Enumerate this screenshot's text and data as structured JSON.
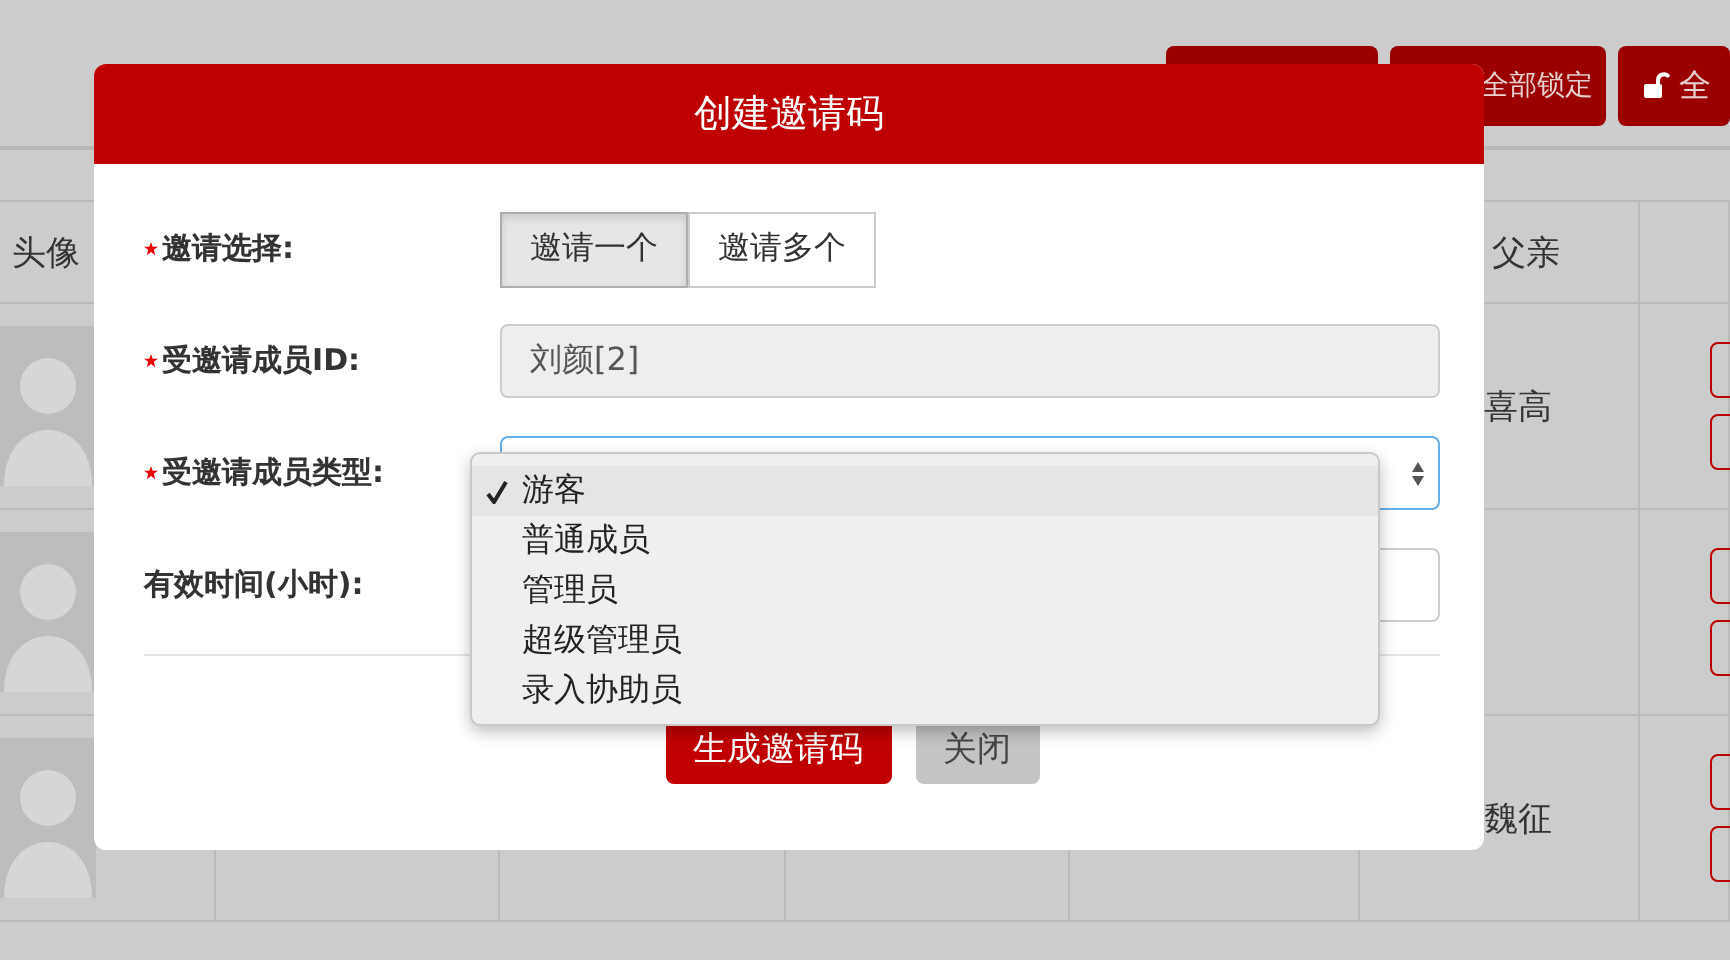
{
  "toolbar_buttons": [
    {
      "kind": "blank"
    },
    {
      "kind": "text",
      "label": "全部锁定"
    },
    {
      "kind": "lock",
      "label": "全"
    }
  ],
  "table": {
    "columns": [
      {
        "label": "头像"
      },
      {
        "label": "父亲"
      }
    ],
    "rows": [
      {
        "father": "喜高"
      },
      {},
      {
        "father": "魏征"
      }
    ]
  },
  "dialog": {
    "title": "创建邀请码",
    "fields": [
      {
        "kind": "toggle",
        "label": "邀请选择:",
        "required": true,
        "options": [
          {
            "label": "邀请一个",
            "selected": true
          },
          {
            "label": "邀请多个",
            "selected": false
          }
        ]
      },
      {
        "kind": "input",
        "label": "受邀请成员ID:",
        "required": true,
        "value": "刘颜[2]",
        "disabled": true
      },
      {
        "kind": "select",
        "label": "受邀请成员类型:",
        "required": true,
        "open": true
      },
      {
        "kind": "input",
        "label": "有效时间(小时):",
        "required": false,
        "disabled": false
      }
    ],
    "dropdown_options": [
      {
        "label": "游客",
        "selected": true
      },
      {
        "label": "普通成员",
        "selected": false
      },
      {
        "label": "管理员",
        "selected": false
      },
      {
        "label": "超级管理员",
        "selected": false
      },
      {
        "label": "录入协助员",
        "selected": false
      }
    ],
    "buttons": [
      {
        "kind": "primary",
        "label": "生成邀请码"
      },
      {
        "kind": "secondary",
        "label": "关闭"
      }
    ]
  }
}
